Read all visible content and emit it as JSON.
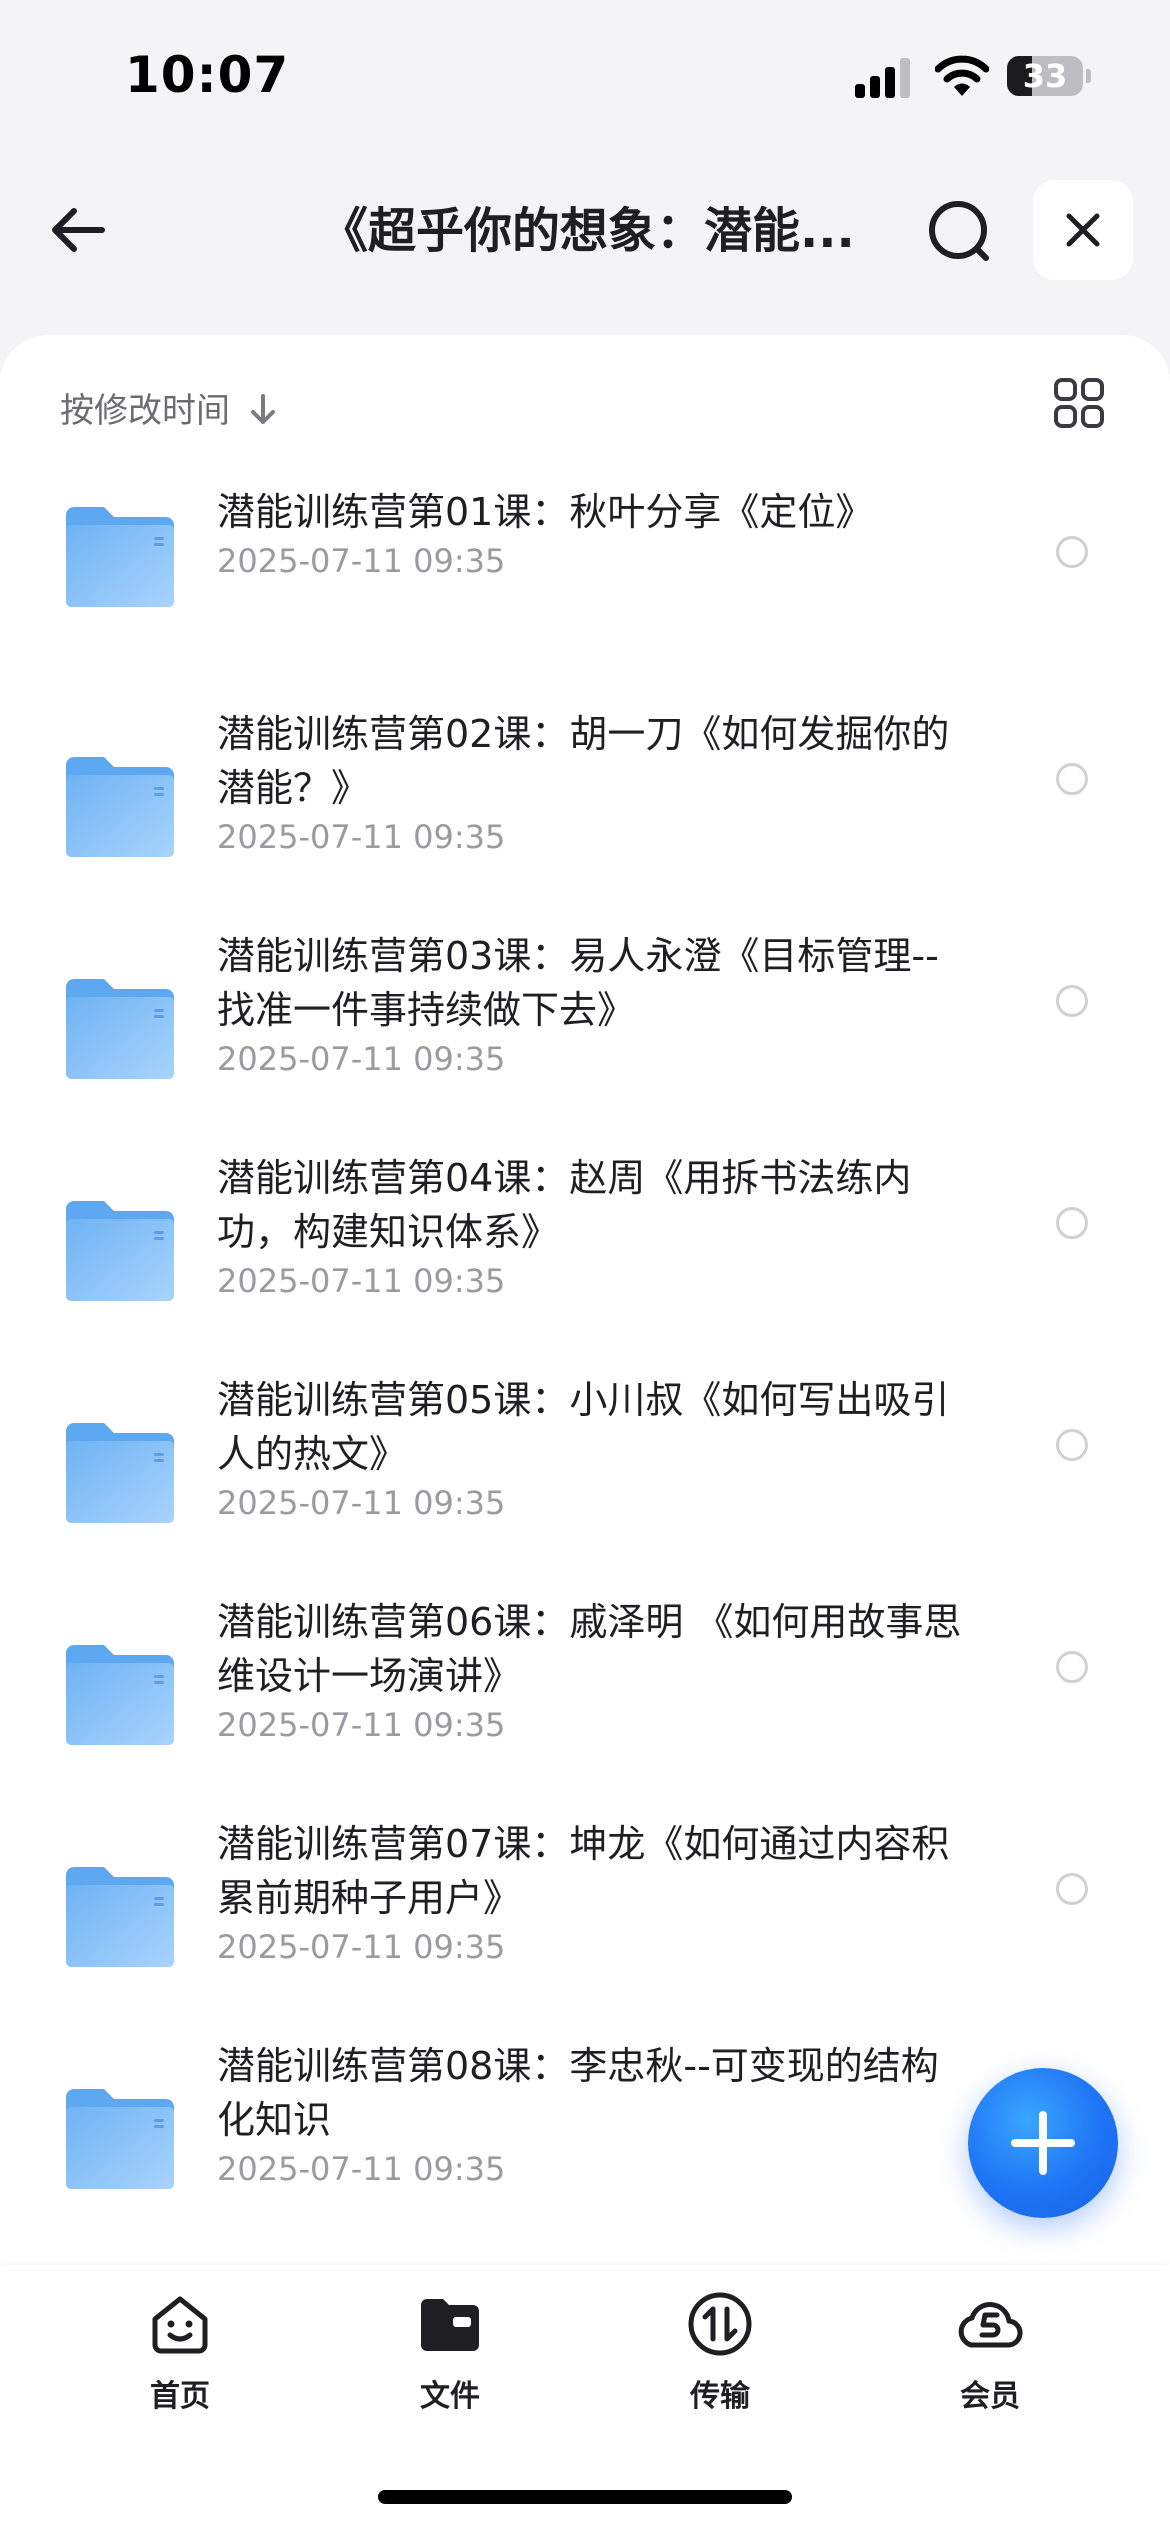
{
  "status_bar": {
    "time": "10:07",
    "battery": "33",
    "battery_level": 0.33
  },
  "nav": {
    "title": "《超乎你的想象：潜能...",
    "back_icon": "arrow-left-icon",
    "search_icon": "search-icon",
    "close_icon": "close-icon"
  },
  "toolbar": {
    "sort_label": "按修改时间",
    "sort_icon": "arrow-down-icon",
    "view_icon": "grid-view-icon"
  },
  "files": [
    {
      "name": "潜能训练营第01课：秋叶分享《定位》",
      "date": "2025-07-11 09:35"
    },
    {
      "name": "潜能训练营第02课：胡一刀《如何发掘你的潜能？》",
      "date": "2025-07-11 09:35"
    },
    {
      "name": "潜能训练营第03课：易人永澄《目标管理--找准一件事持续做下去》",
      "date": "2025-07-11 09:35"
    },
    {
      "name": "潜能训练营第04课：赵周《用拆书法练内功，构建知识体系》",
      "date": "2025-07-11 09:35"
    },
    {
      "name": "潜能训练营第05课：小川叔《如何写出吸引人的热文》",
      "date": "2025-07-11 09:35"
    },
    {
      "name": "潜能训练营第06课：戚泽明 《如何用故事思维设计一场演讲》",
      "date": "2025-07-11 09:35"
    },
    {
      "name": "潜能训练营第07课：坤龙《如何通过内容积累前期种子用户》",
      "date": "2025-07-11 09:35"
    },
    {
      "name": "潜能训练营第08课：李忠秋--可变现的结构化知识",
      "date": "2025-07-11 09:35"
    }
  ],
  "fab": {
    "icon": "plus-icon"
  },
  "tabs": [
    {
      "label": "首页",
      "icon": "home-face-icon"
    },
    {
      "label": "文件",
      "icon": "folder-icon"
    },
    {
      "label": "传输",
      "icon": "transfer-icon"
    },
    {
      "label": "会员",
      "icon": "cloud-member-icon"
    }
  ],
  "colors": {
    "accent": "#1e74f5",
    "folder": "#7fbdf5",
    "text": "#1f1f23",
    "muted": "#9a9aa1"
  }
}
